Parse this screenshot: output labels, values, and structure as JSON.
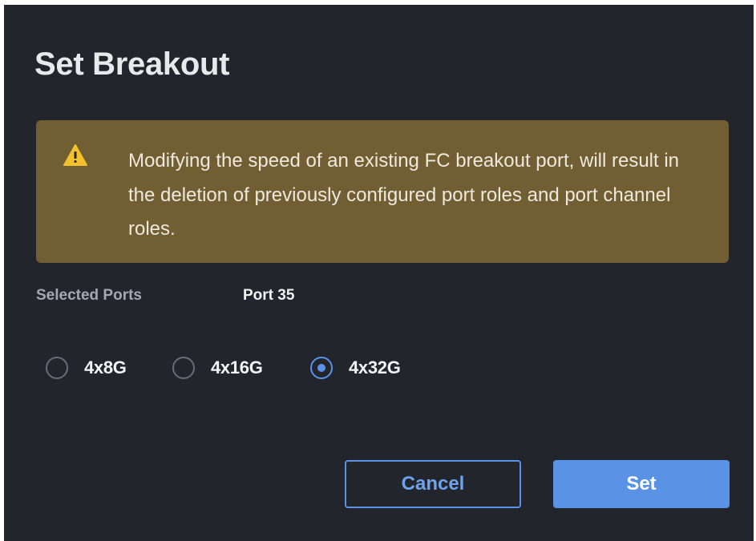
{
  "dialog": {
    "title": "Set Breakout",
    "warning": {
      "icon": "warning-triangle-icon",
      "text": "Modifying the speed of an existing FC breakout port, will result in the deletion of previously configured port roles and port channel roles."
    },
    "selected_ports": {
      "label": "Selected Ports",
      "value": "Port 35"
    },
    "speed_options": [
      {
        "label": "4x8G",
        "checked": false
      },
      {
        "label": "4x16G",
        "checked": false
      },
      {
        "label": "4x32G",
        "checked": true
      }
    ],
    "buttons": {
      "cancel_label": "Cancel",
      "set_label": "Set"
    }
  },
  "colors": {
    "dialog_bg": "#22252b",
    "warning_bg": "#715f33",
    "warning_icon": "#f2c12e",
    "accent": "#5a92e6",
    "text_primary": "#f2f3f5",
    "text_muted": "#a4a8b0"
  }
}
